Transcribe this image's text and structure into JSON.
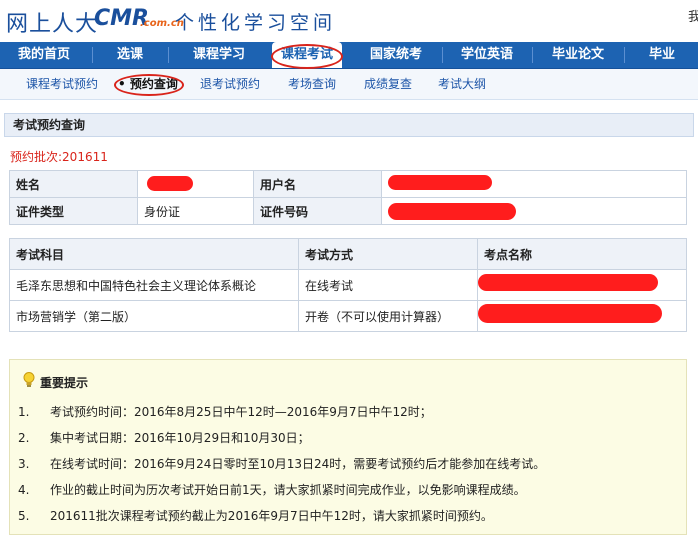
{
  "header": {
    "logo_text": "网上人大",
    "logo_brand": "CMR",
    "logo_domain": ".com.cn",
    "slogan": "个性化学习空间",
    "right_text": "我"
  },
  "main_nav": [
    {
      "label": "我的首页"
    },
    {
      "label": "选课"
    },
    {
      "label": "课程学习"
    },
    {
      "label": "课程考试",
      "active": true
    },
    {
      "label": "国家统考"
    },
    {
      "label": "学位英语"
    },
    {
      "label": "毕业论文"
    },
    {
      "label": "毕业"
    }
  ],
  "sub_nav": [
    {
      "label": "课程考试预约"
    },
    {
      "label": "• 预约查询",
      "active": true
    },
    {
      "label": "退考试预约"
    },
    {
      "label": "考场查询"
    },
    {
      "label": "成绩复查"
    },
    {
      "label": "考试大纲"
    }
  ],
  "section_title": "考试预约查询",
  "batch_label": "预约批次:201611",
  "info": {
    "name_label": "姓名",
    "name_value": "",
    "username_label": "用户名",
    "username_value": "",
    "id_type_label": "证件类型",
    "id_type_value": "身份证",
    "id_number_label": "证件号码",
    "id_number_value": ""
  },
  "exam_table": {
    "headers": [
      "考试科目",
      "考试方式",
      "考点名称"
    ],
    "rows": [
      {
        "subject": "毛泽东思想和中国特色社会主义理论体系概论",
        "method": "在线考试",
        "site": ""
      },
      {
        "subject": "市场营销学（第二版）",
        "method": "开卷（不可以使用计算器）",
        "site": ""
      }
    ]
  },
  "notice": {
    "title": "重要提示",
    "items": [
      {
        "num": "1.",
        "text": "考试预约时间：2016年8月25日中午12时—2016年9月7日中午12时；"
      },
      {
        "num": "2.",
        "text": "集中考试日期：2016年10月29日和10月30日；"
      },
      {
        "num": "3.",
        "text": "在线考试时间：2016年9月24日零时至10月13日24时，需要考试预约后才能参加在线考试。"
      },
      {
        "num": "4.",
        "text": "作业的截止时间为历次考试开始日前1天，请大家抓紧时间完成作业，以免影响课程成绩。"
      },
      {
        "num": "5.",
        "text": "201611批次课程考试预约截止为2016年9月7日中午12时，请大家抓紧时间预约。"
      }
    ]
  },
  "colors": {
    "nav_blue": "#1d63b2",
    "highlight_red": "#d9241b",
    "notice_bg": "#fcfce4",
    "redaction": "#ff1d1d"
  }
}
